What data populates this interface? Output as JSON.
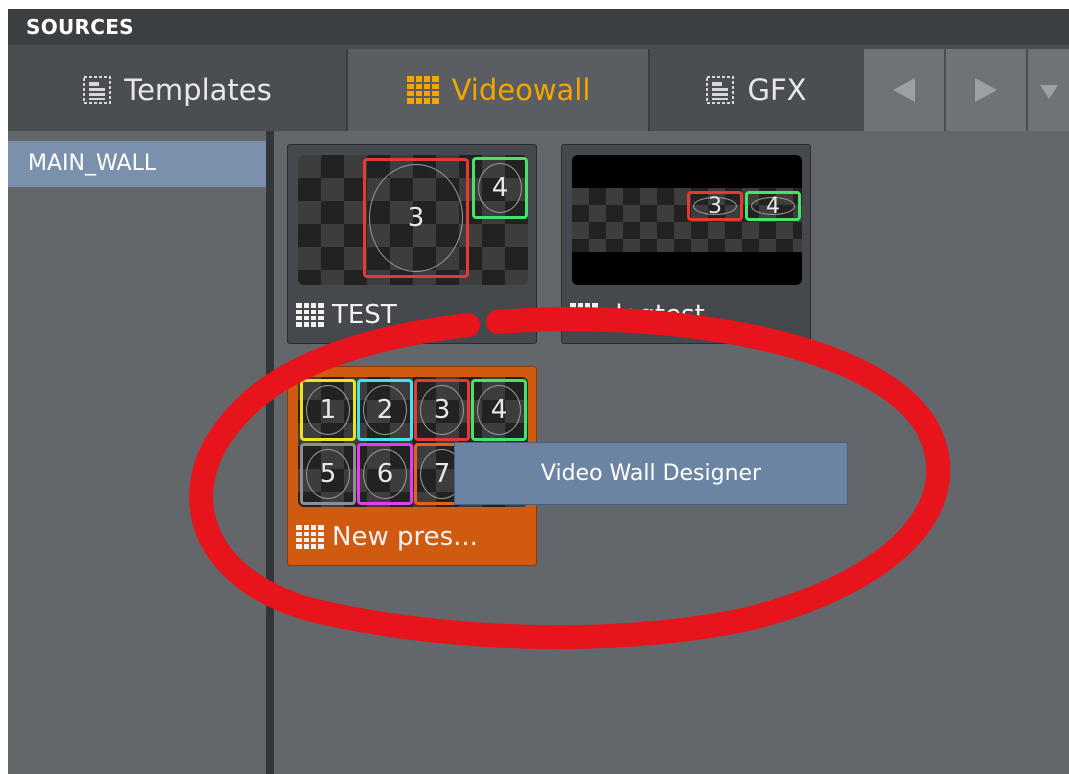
{
  "panel": {
    "title": "SOURCES"
  },
  "tabs": [
    {
      "label": "Templates",
      "icon": "template-icon",
      "active": false
    },
    {
      "label": "Videowall",
      "icon": "videowall-icon",
      "active": true
    },
    {
      "label": "GFX",
      "icon": "template-icon",
      "active": false
    }
  ],
  "nav": {
    "prev": "prev-arrow",
    "next": "next-arrow",
    "more": "dropdown"
  },
  "sidebar": {
    "items": [
      {
        "label": "MAIN_WALL",
        "selected": true
      }
    ]
  },
  "presets": [
    {
      "label": "TEST",
      "cells": [
        "3",
        "4"
      ]
    },
    {
      "label": "dogtest",
      "cells": [
        "3",
        "4"
      ]
    },
    {
      "label": "New pres...",
      "cells": [
        "1",
        "2",
        "3",
        "4",
        "5",
        "6",
        "7"
      ],
      "selected": true
    }
  ],
  "context_menu": {
    "items": [
      "Video Wall Designer"
    ]
  },
  "colors": {
    "accent": "#f5a400",
    "selection": "#cf5a10",
    "sidebar_selected": "#7b90ad",
    "annotation": "#e8141c"
  }
}
